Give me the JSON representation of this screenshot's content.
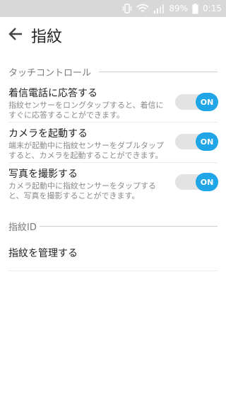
{
  "status_bar": {
    "battery": "89%",
    "time": "0:15",
    "icons": [
      "vibrate-icon",
      "wifi-icon",
      "signal-icon",
      "battery-icon"
    ]
  },
  "app_bar": {
    "title": "指紋",
    "back_icon": "arrow-left-icon"
  },
  "sections": {
    "touch_control": {
      "header": "タッチコントロール",
      "items": [
        {
          "title": "着信電話に応答する",
          "description": "指紋センサーをロングタップすると、着信にすぐに応答することができます。",
          "toggle": "ON"
        },
        {
          "title": "カメラを起動する",
          "description": "端末が起動中に指紋センサーをダブルタップすると、カメラを起動することができます。",
          "toggle": "ON"
        },
        {
          "title": "写真を撮影する",
          "description": "カメラ起動中に指紋センサーをタップすると、写真を撮影することができます。",
          "toggle": "ON"
        }
      ]
    },
    "fingerprint_id": {
      "header": "指紋ID",
      "items": [
        {
          "title": "指紋を管理する"
        }
      ]
    }
  },
  "colors": {
    "accent": "#20a5e6",
    "status_bar": "#d8d8d8"
  }
}
